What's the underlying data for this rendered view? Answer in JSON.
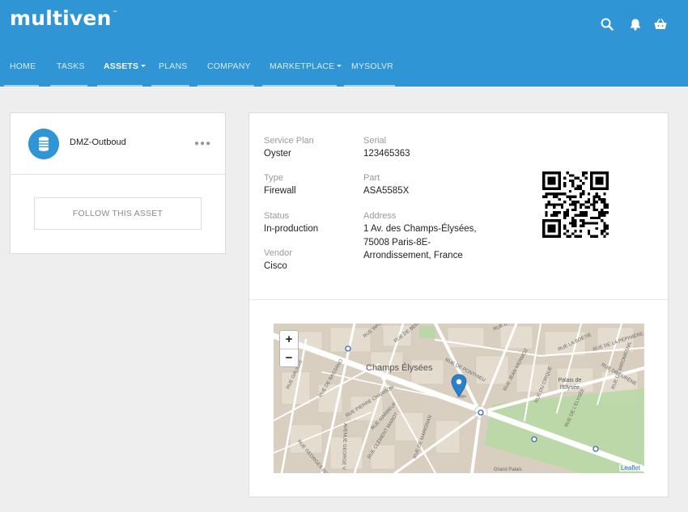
{
  "header": {
    "logo_text": "multiven",
    "logo_mark": "™",
    "background": "#2f95d4",
    "icons": [
      "search-icon",
      "bell-icon",
      "basket-icon"
    ]
  },
  "nav": {
    "items": [
      {
        "label": "HOME",
        "active": false,
        "dropdown": false
      },
      {
        "label": "TASKS",
        "active": false,
        "dropdown": false
      },
      {
        "label": "ASSETS",
        "active": true,
        "dropdown": true
      },
      {
        "label": "PLANS",
        "active": false,
        "dropdown": false
      },
      {
        "label": "COMPANY",
        "active": false,
        "dropdown": false
      },
      {
        "label": "MARKETPLACE",
        "active": false,
        "dropdown": true
      },
      {
        "label": "MYSOLVR",
        "active": false,
        "dropdown": false
      }
    ]
  },
  "asset": {
    "name": "DMZ-Outboud",
    "avatar_icon": "router-icon",
    "more_icon": "more-dots-icon",
    "follow_label": "FOLLOW THIS ASSET"
  },
  "details": {
    "service_plan_label": "Service Plan",
    "service_plan": "Oyster",
    "serial_label": "Serial",
    "serial": "123465363",
    "type_label": "Type",
    "type": "Firewall",
    "part_label": "Part",
    "part": "ASA5585X",
    "status_label": "Status",
    "status": "In-production",
    "address_label": "Address",
    "address_lines": [
      "1 Av. des Champs-Élysées,",
      "75008 Paris-8E-",
      "Arrondissement, France"
    ],
    "vendor_label": "Vendor",
    "vendor": "Cisco"
  },
  "map": {
    "zoom_in": "+",
    "zoom_out": "−",
    "attribution": "Leaflet",
    "place_labels": {
      "champs": "Champs Élysées",
      "palais": "Palais de l'Elysée"
    },
    "streets": [
      "RUE WASHINGTON",
      "RUE DE BERRI",
      "RUE GALILÉE",
      "RUE DE BASSANO",
      "RUE PIERRE CHARRON",
      "AVENUE GEORGE V",
      "RUE MARBEUF",
      "RUE CLÉMENT MAROT",
      "RUE DE MARIGNAN",
      "RUE DE PONTHIEU",
      "RUE JEAN MERMOZ",
      "RUE DU CIRQUE",
      "RUE DE L'ELYSÉE",
      "RUE DE SURÈNE",
      "RUE GEORGES BIZET",
      "RUE D'ARTOIS",
      "RUE LA BOÉTIE",
      "RUE DE MIROMESNIL",
      "RUE DE LA PÉPINIÈRE",
      "Grand Palais"
    ]
  }
}
